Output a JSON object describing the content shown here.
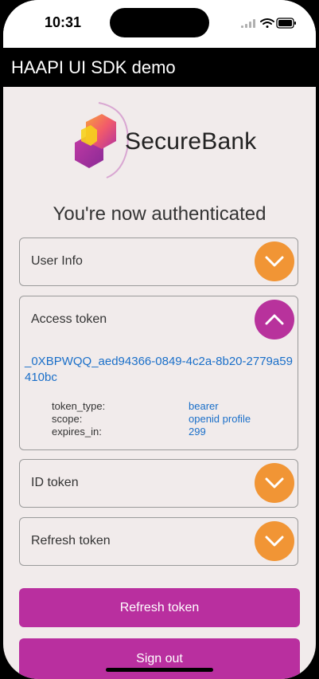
{
  "status_bar": {
    "time": "10:31"
  },
  "app_bar": {
    "title": "HAAPI UI SDK demo"
  },
  "logo": {
    "text": "SecureBank"
  },
  "headline": "You're now authenticated",
  "sections": {
    "user_info": {
      "title": "User Info",
      "expanded": false
    },
    "access_token": {
      "title": "Access token",
      "expanded": true,
      "value": "_0XBPWQQ_aed94366-0849-4c2a-8b20-2779a59410bc",
      "fields": [
        {
          "key": "token_type:",
          "value": "bearer"
        },
        {
          "key": "scope:",
          "value": "openid profile"
        },
        {
          "key": "expires_in:",
          "value": "299"
        }
      ]
    },
    "id_token": {
      "title": "ID token",
      "expanded": false
    },
    "refresh_token": {
      "title": "Refresh token",
      "expanded": false
    }
  },
  "buttons": {
    "refresh": "Refresh token",
    "sign_out": "Sign out"
  },
  "colors": {
    "accent": "#b92f9f",
    "toggle_collapsed": "#f19535",
    "toggle_expanded": "#b8329c",
    "link": "#1a6fc9"
  },
  "icons": {
    "collapsed": "chevron-down-icon",
    "expanded": "chevron-up-icon"
  }
}
